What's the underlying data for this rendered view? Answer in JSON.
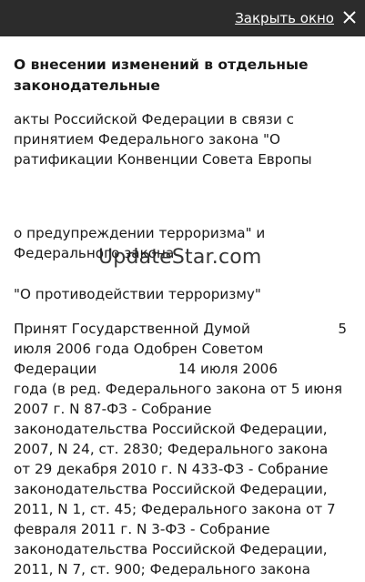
{
  "header": {
    "close_label": "Закрыть окно",
    "close_icon": "close-icon"
  },
  "document": {
    "title": "О внесении изменений в отдельные законодательные",
    "para1": "акты Российской Федерации в связи с принятием Федерального закона \"О ратификации Конвенции Совета Европы",
    "para2": "о предупреждении терроризма\" и Федерального закона",
    "para3": "\"О противодействии терроризму\"",
    "adopted_label": "Принят Государственной Думой",
    "adopted_day": "5",
    "adopted_rest": "июля 2006 года Одобрен Советом",
    "federation_label": "Федерации",
    "approved_date": "14 июля 2006",
    "edits": "года (в ред. Федерального закона от 5 июня 2007 г. N 87-ФЗ - Собрание законодательства Российской Федерации, 2007, N 24, ст. 2830; Федерального закона от 29 декабря 2010 г. N 433-ФЗ - Собрание законодательства Российской Федерации, 2011, N 1, ст. 45; Федерального закона от 7 февраля 2011 г. N 3-ФЗ - Собрание законодательства Российской Федерации, 2011, N 7, ст. 900; Федерального закона"
  },
  "watermark": "UpdateStar.com",
  "colors": {
    "topbar": "#2c2c2c",
    "text": "#1a1a1a"
  }
}
